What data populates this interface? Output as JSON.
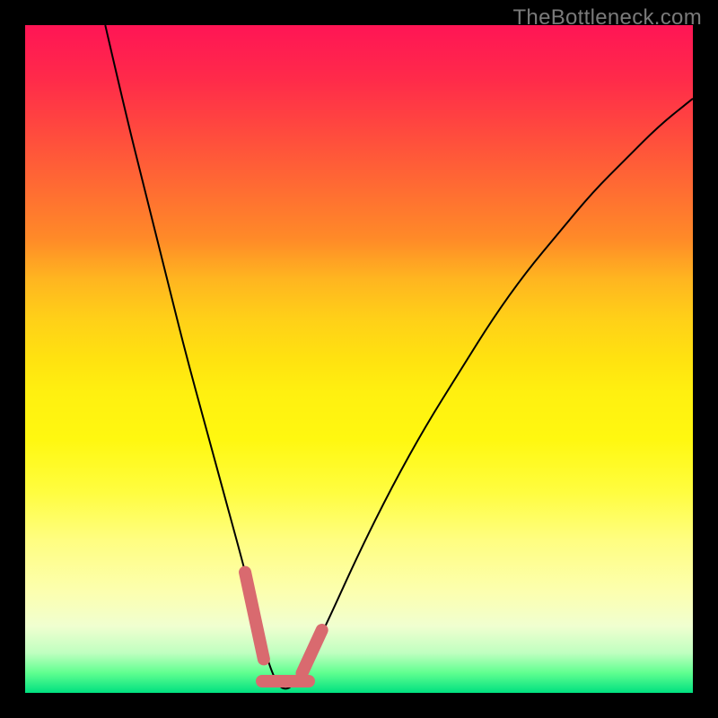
{
  "watermark": "TheBottleneck.com",
  "chart_data": {
    "type": "line",
    "title": "",
    "xlabel": "",
    "ylabel": "",
    "xlim": [
      0,
      100
    ],
    "ylim": [
      0,
      100
    ],
    "grid": false,
    "series": [
      {
        "name": "curve",
        "x": [
          12,
          15,
          18,
          21,
          24,
          27,
          30,
          33,
          35,
          36,
          37,
          38,
          39,
          40,
          42,
          45,
          50,
          55,
          60,
          65,
          70,
          75,
          80,
          85,
          90,
          95,
          100
        ],
        "y": [
          100,
          87,
          75,
          63,
          51,
          40,
          29,
          18,
          10,
          6,
          3,
          1,
          0.5,
          1,
          4,
          10,
          21,
          31,
          40,
          48,
          56,
          63,
          69,
          75,
          80,
          85,
          89
        ],
        "stroke": "#000000",
        "width": 2
      }
    ],
    "markers": [
      {
        "name": "left-arm-marker",
        "x1": 33.0,
        "y1": 18.0,
        "x2": 35.8,
        "y2": 5.0,
        "color": "#d96a6f"
      },
      {
        "name": "trough-marker",
        "x1": 35.5,
        "y1": 1.8,
        "x2": 42.5,
        "y2": 1.8,
        "color": "#d96a6f"
      },
      {
        "name": "right-arm-marker",
        "x1": 41.5,
        "y1": 3.0,
        "x2": 44.5,
        "y2": 9.5,
        "color": "#d96a6f"
      }
    ],
    "background_gradient": {
      "type": "vertical",
      "stops": [
        {
          "pos": 0,
          "color": "#ff1555"
        },
        {
          "pos": 50,
          "color": "#ffe210"
        },
        {
          "pos": 85,
          "color": "#fcffb0"
        },
        {
          "pos": 100,
          "color": "#00e080"
        }
      ]
    }
  }
}
